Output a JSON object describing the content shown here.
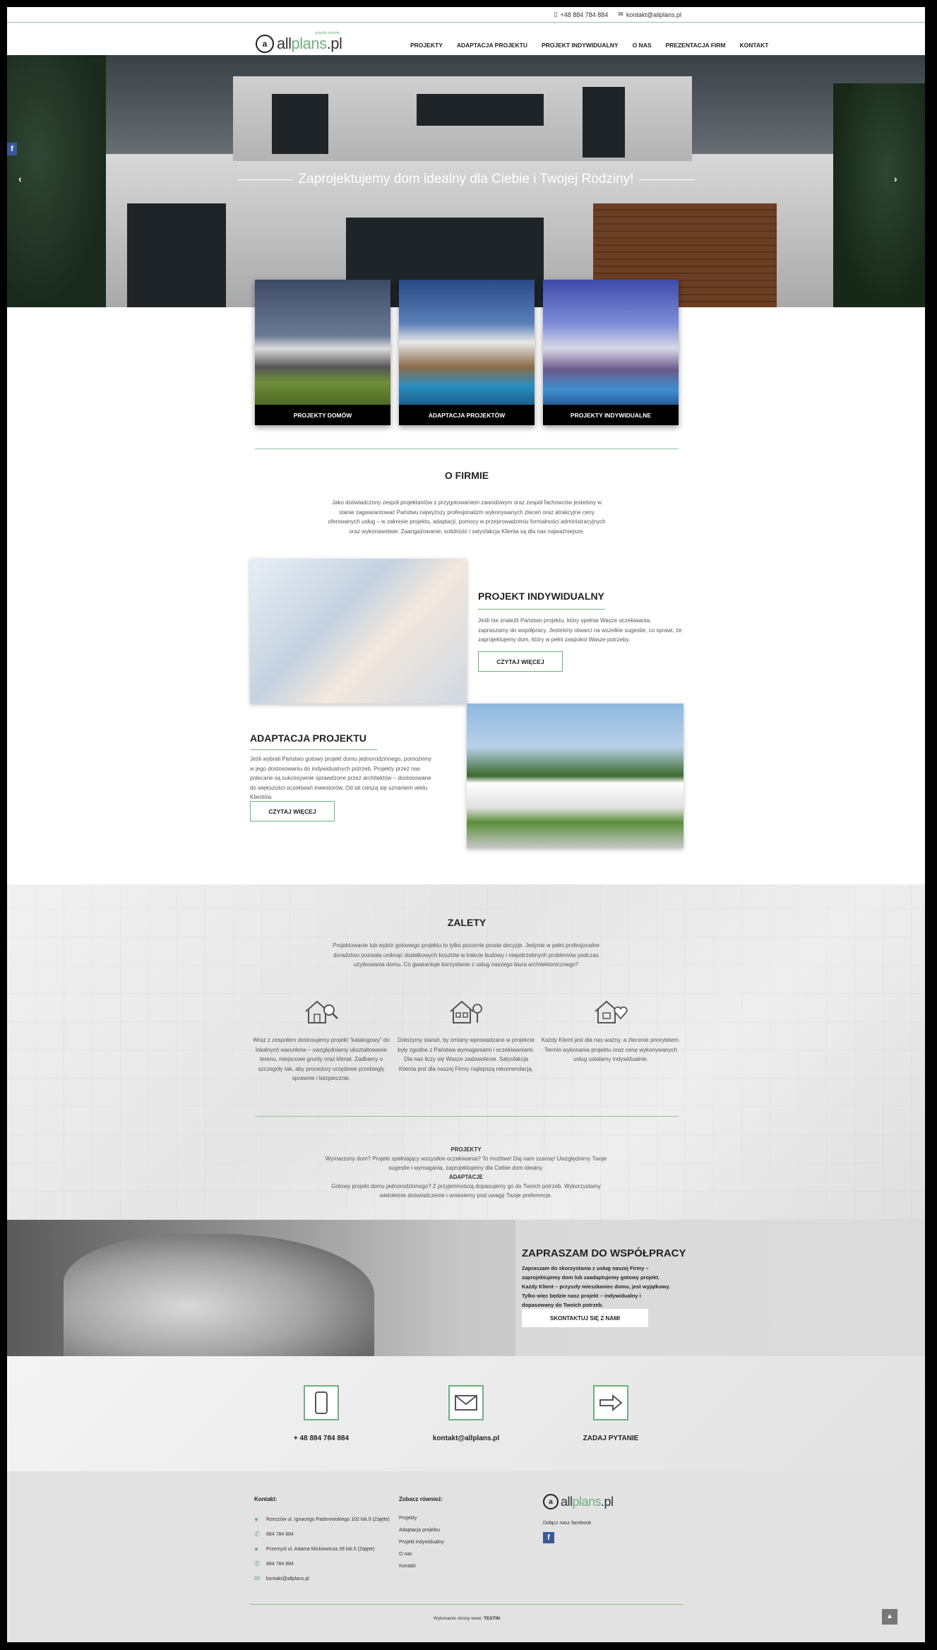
{
  "topbar": {
    "phone": "+48 884 784 884",
    "email": "kontakt@allplans.pl"
  },
  "logo": {
    "mark": "a",
    "brand_a": "all",
    "brand_b": "plans",
    "brand_c": ".pl",
    "sub": "projekty domów"
  },
  "menu": [
    "PROJEKTY",
    "ADAPTACJA PROJEKTU",
    "PROJEKT INDYWIDUALNY",
    "O NAS",
    "PREZENTACJA FIRM",
    "KONTAKT"
  ],
  "hero": {
    "title": "Zaprojektujemy dom idealny dla Ciebie i Twojej Rodziny!",
    "prev": "‹",
    "next": "›",
    "fb": "f"
  },
  "cards": [
    {
      "label": "PROJEKTY DOMÓW"
    },
    {
      "label": "ADAPTACJA PROJEKTÓW"
    },
    {
      "label": "PROJEKTY INDYWIDUALNE"
    }
  ],
  "about": {
    "title": "O FIRMIE",
    "text": "Jako doświadczony zespół projektantów z przygotowaniem zawodowym oraz zespół fachowców jesteśmy w stanie zagwarantować Państwu najwyższy profesjonalizm wykonywanych zleceń oraz atrakcyjne ceny oferowanych usług – w zakresie projektu, adaptacji, pomocy w przeprowadzeniu formalności administracyjnych oraz wykonawstwie. Zaangażowanie, solidność i satysfakcja Klienta są dla nas najważniejsze."
  },
  "individual": {
    "title": "PROJEKT INDYWIDUALNY",
    "text": "Jeśli nie znaleźli Państwo projektu, który spełnia Wasze oczekiwania, zapraszamy do współpracy. Jesteśmy otwarci na wszelkie sugestie, co sprawi, że zaprojektujemy dom, który w pełni zaspokoi Wasze potrzeby.",
    "button": "CZYTAJ WIĘCEJ"
  },
  "adaptation": {
    "title": "ADAPTACJA PROJEKTU",
    "text": "Jeśli wybrali Państwo gotowy projekt domu jednorodzinnego, pomożemy w jego dostosowaniu do indywidualnych potrzeb. Projekty przez nas polecane są sukcesywnie sprawdzone przez architektów – dostosowane do większości oczekiwań inwestorów. Od lat cieszą się uznaniem wielu Klientów.",
    "button": "CZYTAJ WIĘCEJ"
  },
  "zalety": {
    "title": "ZALETY",
    "intro": "Projektowanie lub wybór gotowego projektu to tylko pozornie proste decyzje. Jedynie w pełni profesjonalne doradztwo pozwala uniknąć dodatkowych kosztów w trakcie budowy i niepotrzebnych problemów podczas użytkowania domu. Co gwarantuje korzystanie z usług naszego biura architektonicznego?",
    "items": [
      {
        "icon": "house-search-icon",
        "text": "Wraz z zespołem dostosujemy projekt \"katalogowy\" do lokalnych warunków – uwzględniamy ukształtowanie terenu, miejscowe grunty oraz klimat. Zadbamy o szczegóły tak, aby procedury urzędowe przebiegły sprawnie i bezpiecznie."
      },
      {
        "icon": "house-tree-icon",
        "text": "Dołożymy starań, by zmiany wprowadzane w projekcie były zgodne z Państwa wymaganiami i oczekiwaniami. Dla nas liczy się Wasze zadowolenie. Satysfakcja Klienta jest dla naszej Firmy najlepszą rekomendacją."
      },
      {
        "icon": "house-heart-icon",
        "text": "Każdy Klient jest dla nas ważny, a zlecenie priorytetem. Termin wykonania projektu oraz cenę wykonywanych usług ustalamy indywidualnie."
      }
    ],
    "b1_title": "PROJEKTY",
    "b1_text": "Wymarzony dom? Projekt spełniający wszystkie oczekiwania? To możliwe! Daj nam szansę! Uwzględnimy Twoje sugestie i wymagania, zaprojektujemy dla Ciebie dom idealny.",
    "b2_title": "ADAPTACJE",
    "b2_text": "Gotowy projekt domu jednorodzinnego? Z przyjemnością dopasujemy go do Twoich potrzeb. Wykorzystamy wieloletnie doświadczenie i wniesiemy pod uwagę Twoje preferencje."
  },
  "cta": {
    "title": "ZAPRASZAM DO WSPÓŁPRACY",
    "text": "Zapraszam do skorzystania z usług naszej Firmy – zaprojektujemy dom lub zaadaptujemy gotowy projekt. Każdy Klient – przyszły mieszkaniec domu, jest wyjątkowy. Tylko więc będzie nasz projekt – indywidualny i dopasowany do Twoich potrzeb.",
    "button": "SKONTAKTUJ SIĘ Z NAMI"
  },
  "contact_boxes": [
    {
      "icon": "phone-icon",
      "label": "+ 48 884 784 884"
    },
    {
      "icon": "envelope-icon",
      "label": "kontakt@allplans.pl"
    },
    {
      "icon": "arrow-icon",
      "label": "ZADAJ PYTANIE"
    }
  ],
  "footer": {
    "contact_head": "Kontakt:",
    "rows": [
      {
        "icon": "pin-icon",
        "text": "Rzeszów ul. Ignacego Paderewskiego 102 lok.9 (Zajęte)"
      },
      {
        "icon": "phone-icon",
        "text": "884 784 884"
      },
      {
        "icon": "pin-icon",
        "text": "Przemyśl ul. Adama Mickiewicza 28 lok.5 (Zajęte)"
      },
      {
        "icon": "phone-icon",
        "text": "884 784 884"
      },
      {
        "icon": "mail-icon",
        "text": "kontakt@allplans.pl"
      }
    ],
    "links_head": "Zobacz również:",
    "links": [
      "Projekty",
      "Adaptacja projektu",
      "Projekt indywidualny",
      "O nas",
      "Kontakt"
    ],
    "fb_text": "Dołącz nasz facebook",
    "fb": "f",
    "credits": "Wykonanie strony www:",
    "credits_b": "TESTIN",
    "totop": "▲"
  }
}
